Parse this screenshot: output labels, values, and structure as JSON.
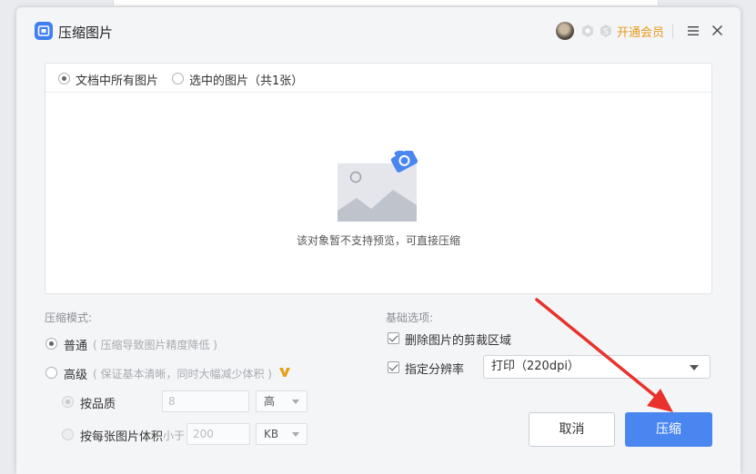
{
  "dialog": {
    "title": "压缩图片",
    "vip_link": "开通会员"
  },
  "scope_tabs": [
    {
      "label": "文档中所有图片",
      "checked": true
    },
    {
      "label": "选中的图片（共1张）",
      "checked": false
    }
  ],
  "preview": {
    "message": "该对象暂不支持预览，可直接压缩"
  },
  "mode": {
    "title": "压缩模式:",
    "normal_label": "普通",
    "normal_hint": "( 压缩导致图片精度降低 )",
    "advanced_label": "高级",
    "advanced_hint": "( 保证基本清晰，同时大幅减少体积 )",
    "by_quality_label": "按品质",
    "quality_value": "8",
    "quality_level": "高",
    "by_size_label": "按每张图片体积",
    "size_prefix": "小于",
    "size_value": "200",
    "size_unit": "KB"
  },
  "basic": {
    "title": "基础选项:",
    "crop_label": "删除图片的剪裁区域",
    "resolution_label": "指定分辨率",
    "resolution_value": "打印（220dpi）"
  },
  "buttons": {
    "cancel": "取消",
    "compress": "压缩"
  },
  "colors": {
    "accent": "#4a86f0",
    "vip": "#e59a1b",
    "annotation_arrow": "#e8322b"
  }
}
